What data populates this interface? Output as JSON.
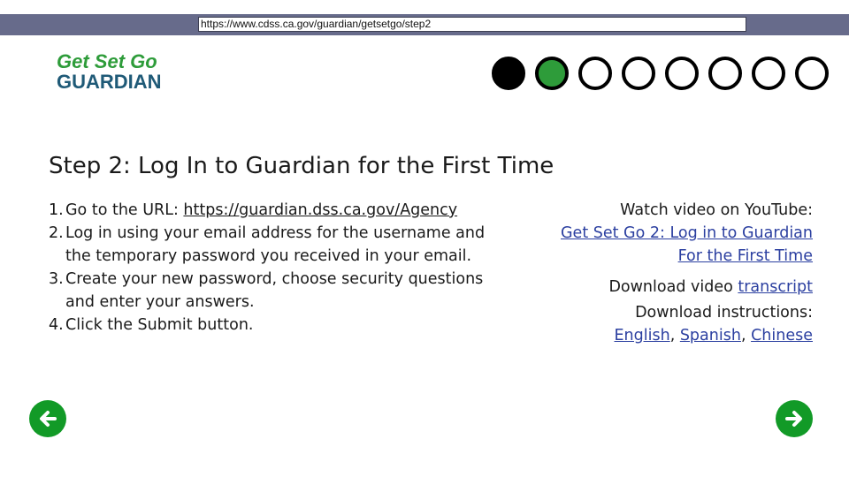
{
  "browser": {
    "url": "https://www.cdss.ca.gov/guardian/getsetgo/step2"
  },
  "logo": {
    "line1": "Get Set Go",
    "line2": "GUARDIAN",
    "colors": {
      "green": "#2e9c3a",
      "blue": "#1f5a77"
    }
  },
  "progress": {
    "total_steps": 8,
    "current_step": 2,
    "steps": [
      "done",
      "current",
      "todo",
      "todo",
      "todo",
      "todo",
      "todo",
      "todo"
    ],
    "colors": {
      "done": "#000000",
      "current": "#2e9c3a",
      "todo": "#ffffff"
    }
  },
  "title": "Step 2: Log In to Guardian for the First Time",
  "instructions": [
    {
      "num": "1.",
      "before": "Go to the URL: ",
      "link": "https://guardian.dss.ca.gov/Agency"
    },
    {
      "num": "2.",
      "text": "Log in using your email address for the username and the temporary password you received in your email."
    },
    {
      "num": "3.",
      "text": "Create your new password, choose security questions and enter your answers."
    },
    {
      "num": "4.",
      "text": "Click the Submit button."
    }
  ],
  "side": {
    "watch_label": "Watch video on YouTube:",
    "video_link_line1": "Get Set Go 2: Log in to Guardian",
    "video_link_line2": "For the First Time",
    "transcript_prefix": "Download video ",
    "transcript_link": "transcript",
    "download_label": "Download instructions:",
    "languages": [
      "English",
      "Spanish",
      "Chinese"
    ],
    "separator": ", ",
    "link_color": "#2b3fa0"
  },
  "nav": {
    "prev_icon": "arrow-left-icon",
    "next_icon": "arrow-right-icon",
    "button_color": "#129a27"
  }
}
